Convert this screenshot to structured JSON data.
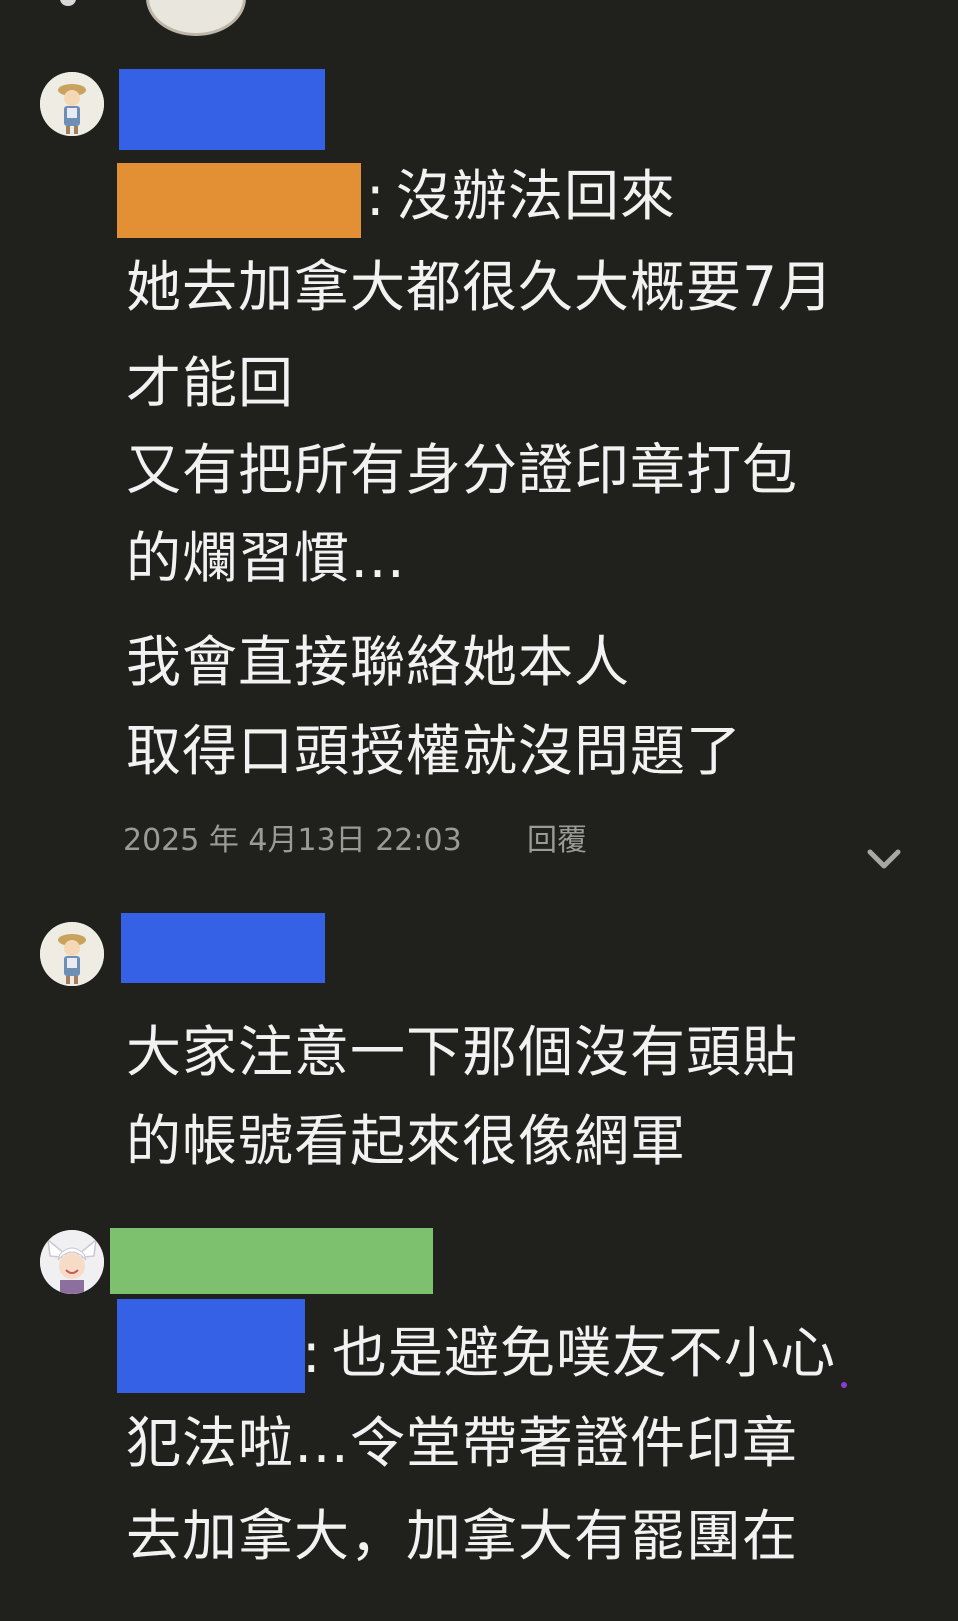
{
  "comments": [
    {
      "reply_prefix": ":",
      "lines": [
        "沒辦法回來",
        "她去加拿大都很久大概要7月",
        "才能回",
        "又有把所有身分證印章打包",
        "的爛習慣…",
        "我會直接聯絡她本人",
        "取得口頭授權就沒問題了"
      ],
      "timestamp": "2025 年 4月13日 22:03",
      "reply_label": "回覆",
      "username_redaction_color": "#3461e6",
      "mention_redaction_color": "#e38f33"
    },
    {
      "lines": [
        "大家注意一下那個沒有頭貼",
        "的帳號看起來很像網軍"
      ],
      "username_redaction_color": "#3461e6"
    },
    {
      "reply_prefix": ":",
      "lines": [
        "也是避免噗友不小心",
        "犯法啦…令堂帶著證件印章",
        "去加拿大，加拿大有罷團在"
      ],
      "username_redaction_color": "#7dc06e",
      "mention_redaction_color": "#3461e6"
    }
  ],
  "icons": {
    "expand": "chevron-down-icon"
  }
}
